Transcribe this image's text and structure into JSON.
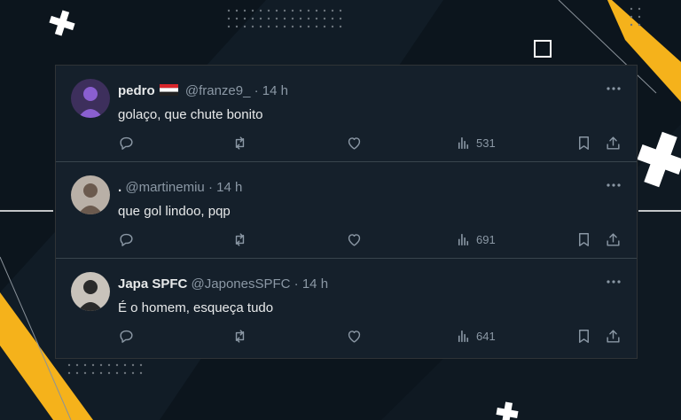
{
  "tweets": [
    {
      "name": "pedro",
      "handle": "@franze9_",
      "separator": "·",
      "time": "14 h",
      "text": "golaço, que chute bonito",
      "views": "531",
      "has_flag": true,
      "avatar_colors": {
        "bg": "#3d2f5c",
        "fg": "#8a5fd0"
      }
    },
    {
      "name": ".",
      "handle": "@martinemiu",
      "separator": "·",
      "time": "14 h",
      "text": "que gol lindoo, pqp",
      "views": "691",
      "has_flag": false,
      "avatar_colors": {
        "bg": "#b9b0a7",
        "fg": "#6b5a4e"
      }
    },
    {
      "name": "Japa SPFC",
      "handle": "@JaponesSPFC",
      "separator": "·",
      "time": "14 h",
      "text": "É o homem, esqueça tudo",
      "views": "641",
      "has_flag": false,
      "avatar_colors": {
        "bg": "#c9c3bb",
        "fg": "#2a2a2a"
      }
    }
  ],
  "icons": {
    "reply": "reply-icon",
    "retweet": "retweet-icon",
    "like": "heart-icon",
    "views": "views-icon",
    "bookmark": "bookmark-icon",
    "share": "share-icon",
    "more": "more-icon"
  },
  "colors": {
    "page_bg": "#0c151d",
    "card_bg": "#15202b",
    "text_primary": "#e7e9ea",
    "text_secondary": "#8b98a5",
    "accent_yellow": "#f5b21b"
  }
}
